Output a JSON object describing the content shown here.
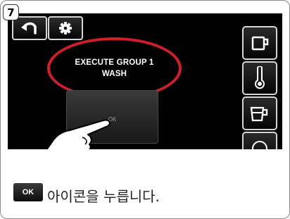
{
  "step_number": "7",
  "screen": {
    "toolbar": {
      "back": "back-icon",
      "settings": "gear-icon"
    },
    "message_lines": [
      "EXECUTE GROUP 1",
      "WASH"
    ],
    "ok_button_label": "OK",
    "side_buttons": [
      "cup-icon",
      "thermometer-icon",
      "milk-jug-icon",
      "circle-icon"
    ],
    "highlight_color": "#d11f2a"
  },
  "instruction": {
    "icon_label": "OK",
    "text": "아이콘을 누릅니다."
  }
}
